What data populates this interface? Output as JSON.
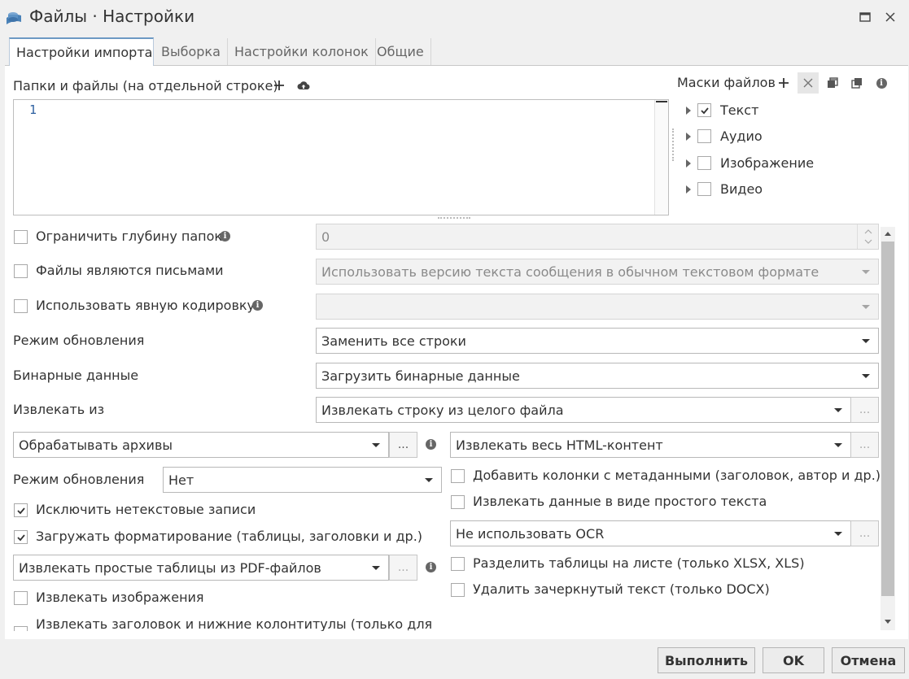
{
  "window": {
    "title": "Файлы · Настройки",
    "app_icon": "database-stack-icon"
  },
  "tabs": [
    {
      "label": "Настройки импорта",
      "active": true
    },
    {
      "label": "Выборка",
      "active": false
    },
    {
      "label": "Настройки колонок",
      "active": false
    },
    {
      "label": "Общие",
      "active": false
    }
  ],
  "folders": {
    "label": "Папки и файлы (на отдельной строке)",
    "line_number": "1"
  },
  "masks": {
    "label": "Маски файлов",
    "items": [
      {
        "label": "Текст",
        "checked": true
      },
      {
        "label": "Аудио",
        "checked": false
      },
      {
        "label": "Изображение",
        "checked": false
      },
      {
        "label": "Видео",
        "checked": false
      }
    ]
  },
  "limit_depth": {
    "label": "Ограничить глубину папок",
    "checked": false,
    "value": "0"
  },
  "emails": {
    "label": "Файлы являются письмами",
    "checked": false,
    "value": "Использовать версию текста сообщения в обычном текстовом формате"
  },
  "encoding": {
    "label": "Использовать явную кодировку",
    "checked": false,
    "value": ""
  },
  "update_mode": {
    "label": "Режим обновления",
    "value": "Заменить все строки"
  },
  "binary": {
    "label": "Бинарные данные",
    "value": "Загрузить бинарные данные"
  },
  "extract_from": {
    "label": "Извлекать из",
    "value": "Извлекать строку из целого файла",
    "dots": "..."
  },
  "archives": {
    "value": "Обрабатывать архивы",
    "dots": "..."
  },
  "html": {
    "value": "Извлекать весь HTML-контент",
    "dots": "..."
  },
  "update_mode2": {
    "label": "Режим обновления",
    "value": "Нет"
  },
  "metadata_cols": {
    "label": "Добавить колонки с метаданными (заголовок, автор и др.)",
    "checked": false
  },
  "plain_text": {
    "label": "Извлекать данные в виде простого текста",
    "checked": false
  },
  "exclude_nontext": {
    "label": "Исключить нетекстовые записи",
    "checked": true
  },
  "ocr": {
    "value": "Не использовать OCR",
    "dots": "..."
  },
  "load_formatting": {
    "label": "Загружать форматирование (таблицы, заголовки и др.)",
    "checked": true
  },
  "pdf_tables": {
    "value": "Извлекать простые таблицы из PDF-файлов",
    "dots": "..."
  },
  "split_tables": {
    "label": "Разделить таблицы на листе (только XLSX, XLS)",
    "checked": false
  },
  "strikethrough": {
    "label": "Удалить зачеркнутый текст (только DOCX)",
    "checked": false
  },
  "extract_images": {
    "label": "Извлекать изображения",
    "checked": false
  },
  "headers_footers": {
    "label": "Извлекать заголовок и нижние колонтитулы (только для",
    "checked": false
  },
  "buttons": {
    "run": "Выполнить",
    "ok": "OK",
    "cancel": "Отмена"
  },
  "colors": {
    "accent": "#6d99c4",
    "check": "#333333"
  }
}
